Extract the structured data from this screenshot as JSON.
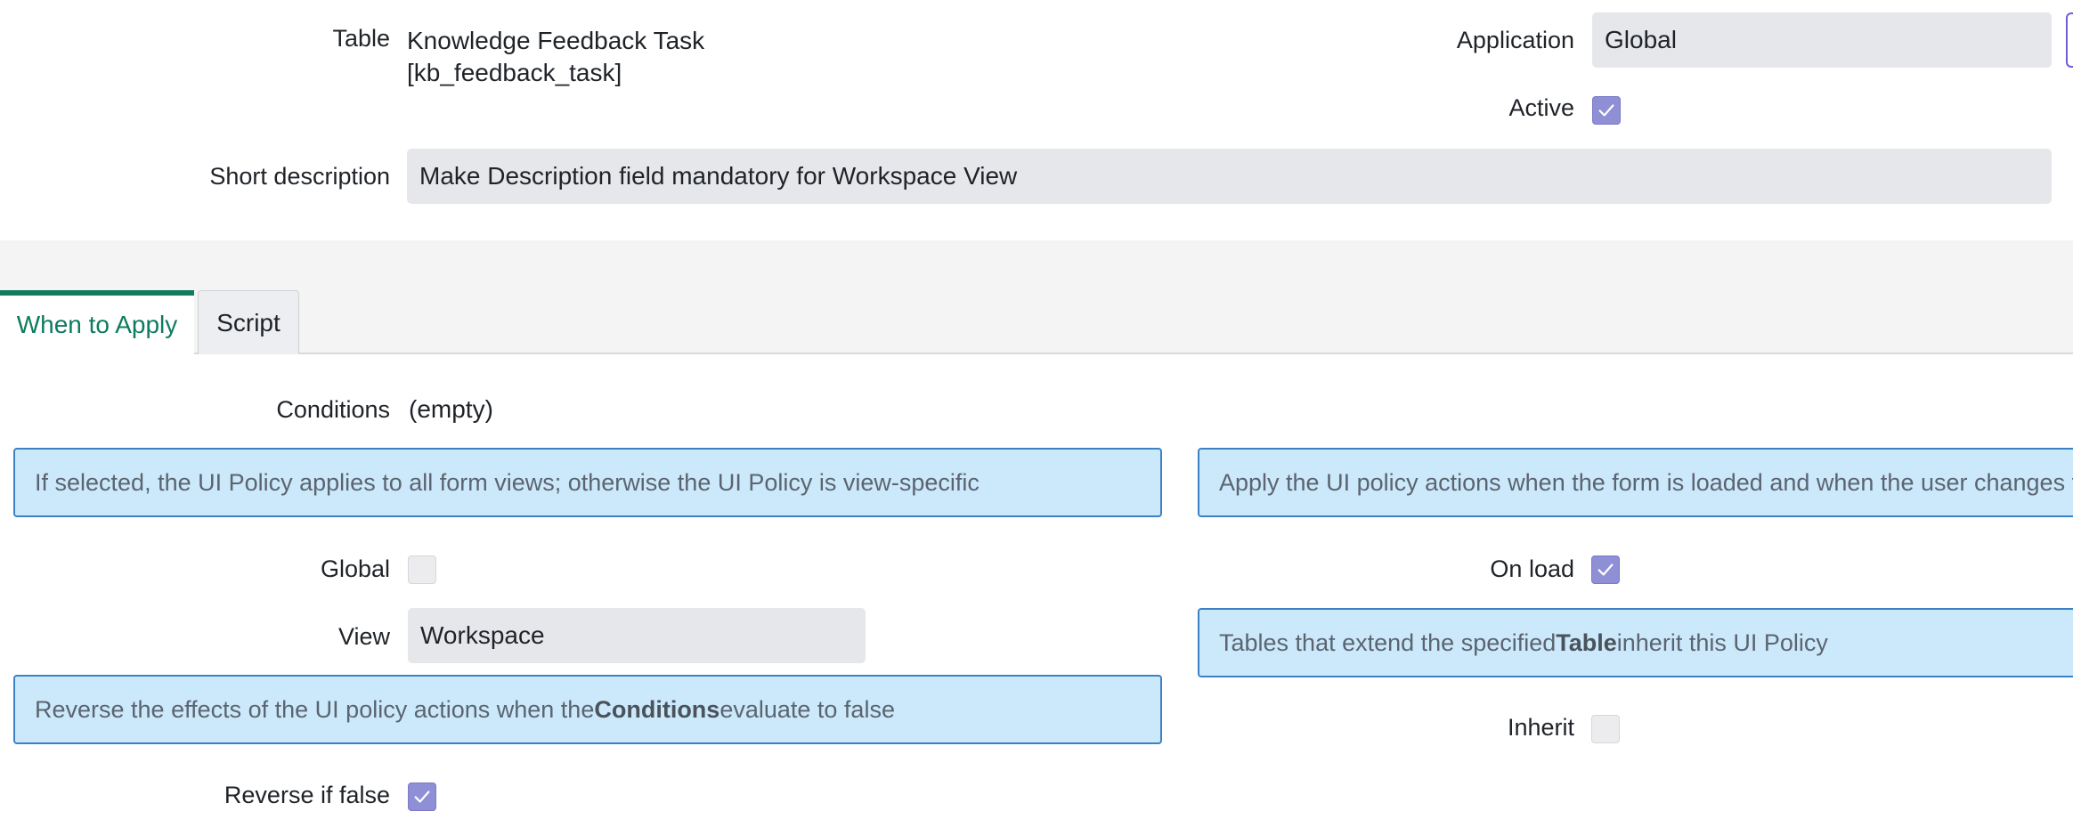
{
  "form": {
    "table_label": "Table",
    "table_name": "Knowledge Feedback Task",
    "table_id": "[kb_feedback_task]",
    "application_label": "Application",
    "application_value": "Global",
    "active_label": "Active",
    "active_checked": true,
    "short_description_label": "Short description",
    "short_description_value": "Make Description field mandatory for Workspace View"
  },
  "tabs": [
    {
      "label": "When to Apply",
      "active": true
    },
    {
      "label": "Script",
      "active": false
    }
  ],
  "when_to_apply": {
    "conditions_label": "Conditions",
    "conditions_value": "(empty)",
    "global_info_text": "If selected, the UI Policy applies to all form views; otherwise the UI Policy is view-specific",
    "onload_info_text": "Apply the UI policy actions when the form is loaded and when the user changes t",
    "global_label": "Global",
    "global_checked": false,
    "onload_label": "On load",
    "onload_checked": true,
    "view_label": "View",
    "view_value": "Workspace",
    "inherit_info": {
      "before": "Tables that extend the specified ",
      "bold": "Table",
      "after": " inherit this UI Policy"
    },
    "reverse_info": {
      "before": "Reverse the effects of the UI policy actions when the ",
      "bold": "Conditions",
      "after": " evaluate to false"
    },
    "inherit_label": "Inherit",
    "inherit_checked": false,
    "reverse_label": "Reverse if false",
    "reverse_checked": true
  },
  "icons": {
    "checkmark": "checkmark-icon"
  },
  "colors": {
    "accent_green": "#0f7b5f",
    "checkbox_purple": "#8f8fd6",
    "info_bg": "#cce9fb",
    "info_border": "#3b82c4"
  }
}
